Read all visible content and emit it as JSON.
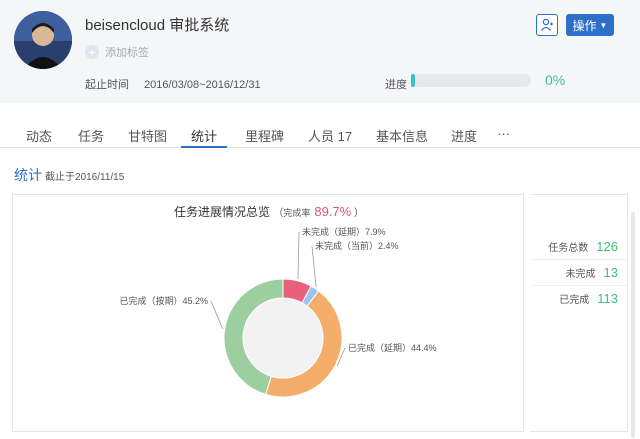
{
  "header": {
    "title": "beisencloud 审批系统",
    "add_tag": "添加标签",
    "date_label": "起止时间",
    "date_range": "2016/03/08~2016/12/31",
    "progress_label": "进度",
    "progress_value": "0%",
    "progress_fraction": 0.03,
    "operate_button": "操作",
    "accent_color": "#2e6fc9"
  },
  "tabs": [
    {
      "label": "动态"
    },
    {
      "label": "任务"
    },
    {
      "label": "甘特图"
    },
    {
      "label": "统计",
      "active": true
    },
    {
      "label": "里程碑"
    },
    {
      "label": "人员 17"
    },
    {
      "label": "基本信息"
    },
    {
      "label": "进度"
    },
    {
      "label": "···"
    }
  ],
  "stats": {
    "heading": "统计",
    "as_of": "截止于2016/11/15"
  },
  "chart_data": {
    "type": "pie",
    "title": "任务进展情况总览",
    "subtitle_label": "完成率",
    "completion_rate": "89.7%",
    "slices": [
      {
        "label": "未完成（延期）",
        "value": 7.9,
        "display": "未完成（延期）7.9%",
        "color": "#e8607c"
      },
      {
        "label": "未完成（当前）",
        "value": 2.4,
        "display": "未完成（当前）2.4%",
        "color": "#9cc4f0"
      },
      {
        "label": "已完成（延期）",
        "value": 44.4,
        "display": "已完成（延期）44.4%",
        "color": "#f4ad6b"
      },
      {
        "label": "已完成（按期）",
        "value": 45.2,
        "display": "已完成（按期）45.2%",
        "color": "#9ccea0"
      }
    ]
  },
  "summary": [
    {
      "label": "任务总数",
      "value": "126"
    },
    {
      "label": "未完成",
      "value": "13"
    },
    {
      "label": "已完成",
      "value": "113"
    }
  ]
}
